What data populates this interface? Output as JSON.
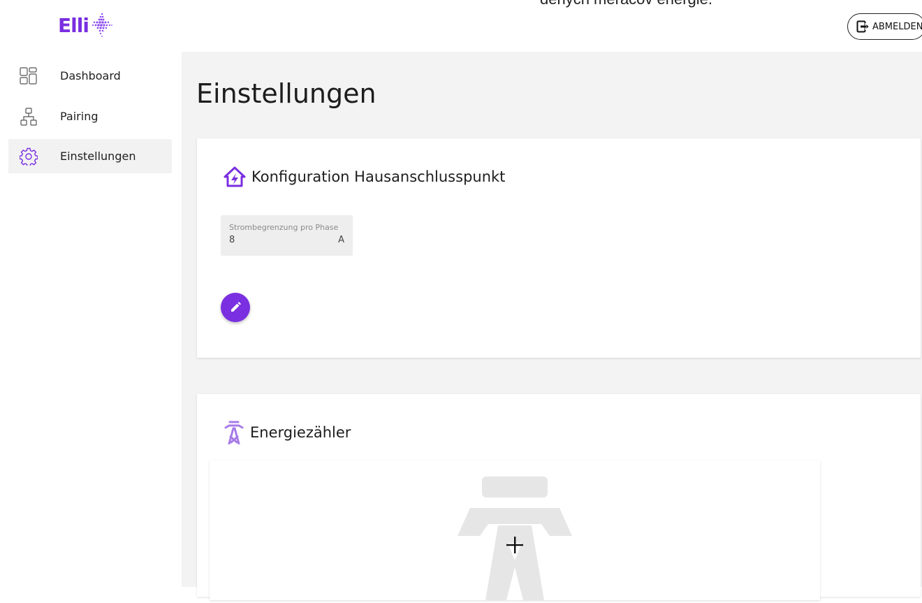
{
  "header": {
    "logo_text": "Elli",
    "overflow_text": "dených meračov energie.",
    "logout_label": "ABMELDEN"
  },
  "sidebar": {
    "items": [
      {
        "label": "Dashboard",
        "icon": "dashboard-icon",
        "active": false
      },
      {
        "label": "Pairing",
        "icon": "pairing-icon",
        "active": false
      },
      {
        "label": "Einstellungen",
        "icon": "settings-gear-icon",
        "active": true
      }
    ]
  },
  "main": {
    "title": "Einstellungen",
    "cards": {
      "connection": {
        "title": "Konfiguration Hausanschlusspunkt",
        "icon": "house-lightning-icon",
        "field": {
          "label": "Strombegrenzung pro Phase",
          "value": "8",
          "unit": "A"
        },
        "edit_icon": "pencil-icon"
      },
      "meter": {
        "title": "Energiezähler",
        "icon": "power-pylon-icon",
        "add_icon": "plus-icon"
      }
    }
  },
  "colors": {
    "brand": "#7a2fe0",
    "background": "#f3f3f3",
    "card": "#ffffff"
  }
}
